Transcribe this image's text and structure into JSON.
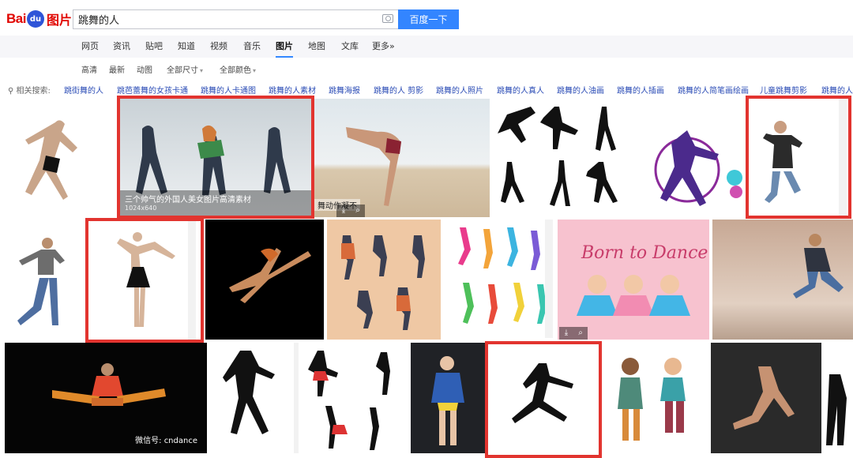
{
  "brand": {
    "logo_text_1": "Bai",
    "logo_text_2": "du",
    "logo_text_3": "图片"
  },
  "search": {
    "value": "跳舞的人",
    "button_label": "百度一下"
  },
  "nav": {
    "tabs": [
      "网页",
      "资讯",
      "贴吧",
      "知道",
      "视频",
      "音乐",
      "图片",
      "地图",
      "文库",
      "更多»"
    ],
    "active": "图片"
  },
  "filters": {
    "items": [
      "高清",
      "最新",
      "动图",
      "全部尺寸",
      "全部颜色"
    ]
  },
  "related": {
    "label": "相关搜索:",
    "items": [
      "跳街舞的人",
      "跳芭蕾舞的女孩卡通",
      "跳舞的人卡通图",
      "跳舞的人素材",
      "跳舞海报",
      "跳舞的人 剪影",
      "跳舞的人照片",
      "跳舞的人真人",
      "跳舞的人油画",
      "跳舞的人插画",
      "跳舞的人简笔画绘画",
      "儿童跳舞剪影",
      "跳舞的人"
    ]
  },
  "results": {
    "tile2_caption": "三个帅气的外国人美女图片高清素材",
    "tile2_size": "1024x640",
    "tile3_caption": "舞动作凝不",
    "tile8_text": "Born to Dance",
    "tile13_watermark": "微信号: cndance"
  },
  "colors": {
    "accent": "#3385ff",
    "highlight": "#e2342f",
    "link": "#2b4cb6",
    "logo_red": "#e10601"
  }
}
